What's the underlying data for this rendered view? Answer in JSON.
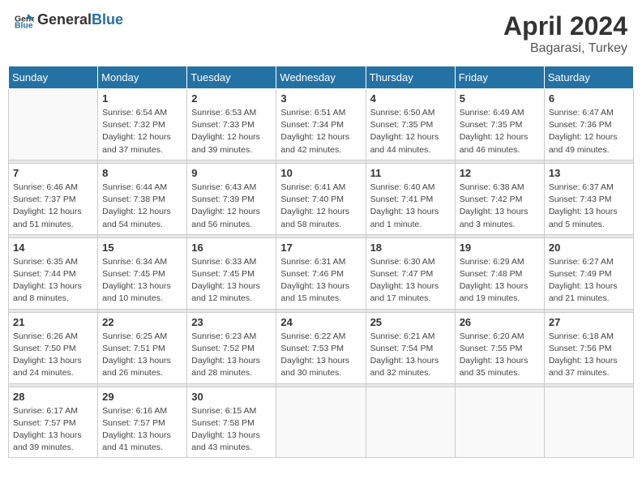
{
  "header": {
    "logo_general": "General",
    "logo_blue": "Blue",
    "month": "April 2024",
    "location": "Bagarasi, Turkey"
  },
  "weekdays": [
    "Sunday",
    "Monday",
    "Tuesday",
    "Wednesday",
    "Thursday",
    "Friday",
    "Saturday"
  ],
  "weeks": [
    [
      {
        "day": "",
        "sunrise": "",
        "sunset": "",
        "daylight": ""
      },
      {
        "day": "1",
        "sunrise": "Sunrise: 6:54 AM",
        "sunset": "Sunset: 7:32 PM",
        "daylight": "Daylight: 12 hours and 37 minutes."
      },
      {
        "day": "2",
        "sunrise": "Sunrise: 6:53 AM",
        "sunset": "Sunset: 7:33 PM",
        "daylight": "Daylight: 12 hours and 39 minutes."
      },
      {
        "day": "3",
        "sunrise": "Sunrise: 6:51 AM",
        "sunset": "Sunset: 7:34 PM",
        "daylight": "Daylight: 12 hours and 42 minutes."
      },
      {
        "day": "4",
        "sunrise": "Sunrise: 6:50 AM",
        "sunset": "Sunset: 7:35 PM",
        "daylight": "Daylight: 12 hours and 44 minutes."
      },
      {
        "day": "5",
        "sunrise": "Sunrise: 6:49 AM",
        "sunset": "Sunset: 7:35 PM",
        "daylight": "Daylight: 12 hours and 46 minutes."
      },
      {
        "day": "6",
        "sunrise": "Sunrise: 6:47 AM",
        "sunset": "Sunset: 7:36 PM",
        "daylight": "Daylight: 12 hours and 49 minutes."
      }
    ],
    [
      {
        "day": "7",
        "sunrise": "Sunrise: 6:46 AM",
        "sunset": "Sunset: 7:37 PM",
        "daylight": "Daylight: 12 hours and 51 minutes."
      },
      {
        "day": "8",
        "sunrise": "Sunrise: 6:44 AM",
        "sunset": "Sunset: 7:38 PM",
        "daylight": "Daylight: 12 hours and 54 minutes."
      },
      {
        "day": "9",
        "sunrise": "Sunrise: 6:43 AM",
        "sunset": "Sunset: 7:39 PM",
        "daylight": "Daylight: 12 hours and 56 minutes."
      },
      {
        "day": "10",
        "sunrise": "Sunrise: 6:41 AM",
        "sunset": "Sunset: 7:40 PM",
        "daylight": "Daylight: 12 hours and 58 minutes."
      },
      {
        "day": "11",
        "sunrise": "Sunrise: 6:40 AM",
        "sunset": "Sunset: 7:41 PM",
        "daylight": "Daylight: 13 hours and 1 minute."
      },
      {
        "day": "12",
        "sunrise": "Sunrise: 6:38 AM",
        "sunset": "Sunset: 7:42 PM",
        "daylight": "Daylight: 13 hours and 3 minutes."
      },
      {
        "day": "13",
        "sunrise": "Sunrise: 6:37 AM",
        "sunset": "Sunset: 7:43 PM",
        "daylight": "Daylight: 13 hours and 5 minutes."
      }
    ],
    [
      {
        "day": "14",
        "sunrise": "Sunrise: 6:35 AM",
        "sunset": "Sunset: 7:44 PM",
        "daylight": "Daylight: 13 hours and 8 minutes."
      },
      {
        "day": "15",
        "sunrise": "Sunrise: 6:34 AM",
        "sunset": "Sunset: 7:45 PM",
        "daylight": "Daylight: 13 hours and 10 minutes."
      },
      {
        "day": "16",
        "sunrise": "Sunrise: 6:33 AM",
        "sunset": "Sunset: 7:45 PM",
        "daylight": "Daylight: 13 hours and 12 minutes."
      },
      {
        "day": "17",
        "sunrise": "Sunrise: 6:31 AM",
        "sunset": "Sunset: 7:46 PM",
        "daylight": "Daylight: 13 hours and 15 minutes."
      },
      {
        "day": "18",
        "sunrise": "Sunrise: 6:30 AM",
        "sunset": "Sunset: 7:47 PM",
        "daylight": "Daylight: 13 hours and 17 minutes."
      },
      {
        "day": "19",
        "sunrise": "Sunrise: 6:29 AM",
        "sunset": "Sunset: 7:48 PM",
        "daylight": "Daylight: 13 hours and 19 minutes."
      },
      {
        "day": "20",
        "sunrise": "Sunrise: 6:27 AM",
        "sunset": "Sunset: 7:49 PM",
        "daylight": "Daylight: 13 hours and 21 minutes."
      }
    ],
    [
      {
        "day": "21",
        "sunrise": "Sunrise: 6:26 AM",
        "sunset": "Sunset: 7:50 PM",
        "daylight": "Daylight: 13 hours and 24 minutes."
      },
      {
        "day": "22",
        "sunrise": "Sunrise: 6:25 AM",
        "sunset": "Sunset: 7:51 PM",
        "daylight": "Daylight: 13 hours and 26 minutes."
      },
      {
        "day": "23",
        "sunrise": "Sunrise: 6:23 AM",
        "sunset": "Sunset: 7:52 PM",
        "daylight": "Daylight: 13 hours and 28 minutes."
      },
      {
        "day": "24",
        "sunrise": "Sunrise: 6:22 AM",
        "sunset": "Sunset: 7:53 PM",
        "daylight": "Daylight: 13 hours and 30 minutes."
      },
      {
        "day": "25",
        "sunrise": "Sunrise: 6:21 AM",
        "sunset": "Sunset: 7:54 PM",
        "daylight": "Daylight: 13 hours and 32 minutes."
      },
      {
        "day": "26",
        "sunrise": "Sunrise: 6:20 AM",
        "sunset": "Sunset: 7:55 PM",
        "daylight": "Daylight: 13 hours and 35 minutes."
      },
      {
        "day": "27",
        "sunrise": "Sunrise: 6:18 AM",
        "sunset": "Sunset: 7:56 PM",
        "daylight": "Daylight: 13 hours and 37 minutes."
      }
    ],
    [
      {
        "day": "28",
        "sunrise": "Sunrise: 6:17 AM",
        "sunset": "Sunset: 7:57 PM",
        "daylight": "Daylight: 13 hours and 39 minutes."
      },
      {
        "day": "29",
        "sunrise": "Sunrise: 6:16 AM",
        "sunset": "Sunset: 7:57 PM",
        "daylight": "Daylight: 13 hours and 41 minutes."
      },
      {
        "day": "30",
        "sunrise": "Sunrise: 6:15 AM",
        "sunset": "Sunset: 7:58 PM",
        "daylight": "Daylight: 13 hours and 43 minutes."
      },
      {
        "day": "",
        "sunrise": "",
        "sunset": "",
        "daylight": ""
      },
      {
        "day": "",
        "sunrise": "",
        "sunset": "",
        "daylight": ""
      },
      {
        "day": "",
        "sunrise": "",
        "sunset": "",
        "daylight": ""
      },
      {
        "day": "",
        "sunrise": "",
        "sunset": "",
        "daylight": ""
      }
    ]
  ]
}
